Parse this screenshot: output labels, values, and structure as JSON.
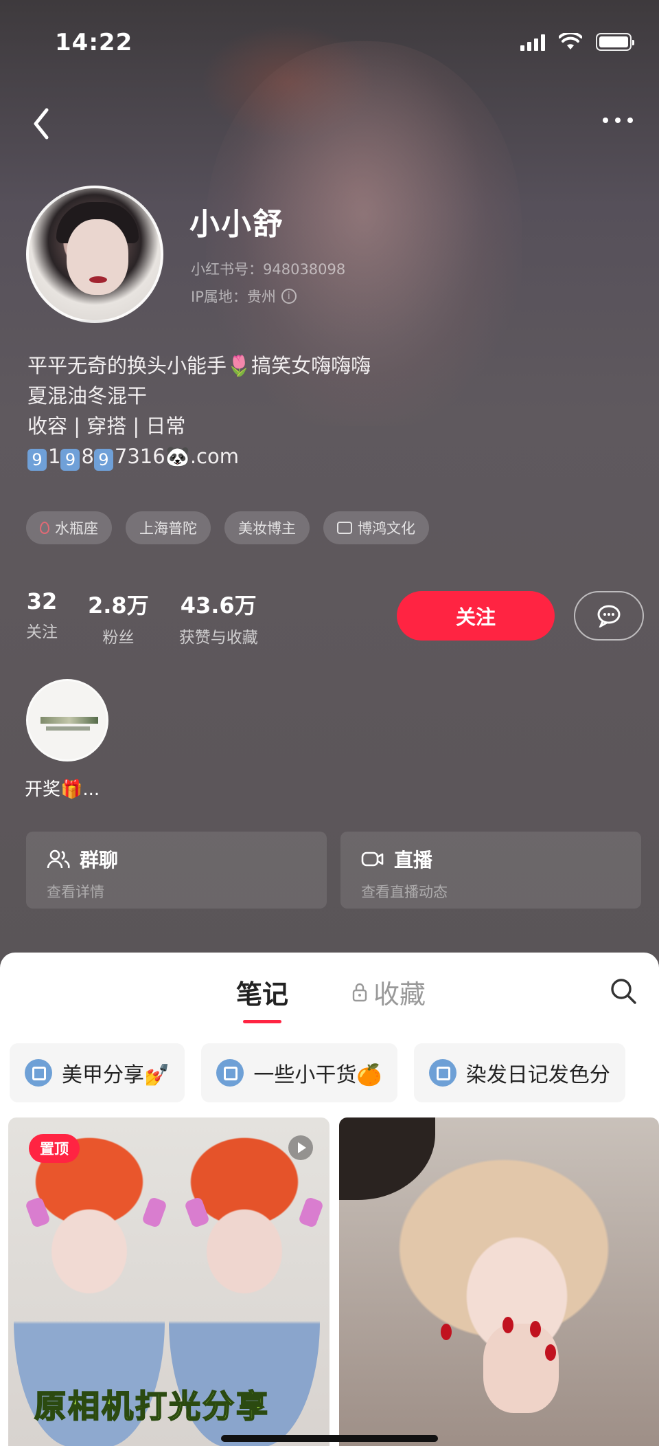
{
  "status_bar": {
    "time": "14:22"
  },
  "profile": {
    "username": "小小舒",
    "red_id": "小红书号：948038098",
    "ip_location": "IP属地：贵州",
    "bio_lines": [
      "平平无奇的换头小能手🌷搞笑女嗨嗨嗨",
      "夏混油冬混干",
      "收容 | 穿搭 | 日常"
    ],
    "contact": {
      "digits": [
        "9",
        "1",
        "9",
        "8",
        "9"
      ],
      "plain_1": "1",
      "plain_2": "8",
      "suffix": "7316",
      "emoji": "🐼",
      "domain": ".com"
    },
    "tags": [
      "水瓶座",
      "上海普陀",
      "美妆博主",
      "博鸿文化"
    ],
    "stats": [
      {
        "value": "32",
        "label": "关注"
      },
      {
        "value": "2.8万",
        "label": "粉丝"
      },
      {
        "value": "43.6万",
        "label": "获赞与收藏"
      }
    ],
    "follow_label": "关注",
    "highlight_label": "开奖🎁..."
  },
  "cards": [
    {
      "title": "群聊",
      "subtitle": "查看详情",
      "icon": "group-icon"
    },
    {
      "title": "直播",
      "subtitle": "查看直播动态",
      "icon": "live-icon"
    }
  ],
  "content": {
    "tabs": {
      "notes": "笔记",
      "favorites": "收藏"
    },
    "albums": [
      "美甲分享💅",
      "一些小干货🍊",
      "染发日记发色分"
    ],
    "notes": [
      {
        "badge": "置顶",
        "caption": "原相机打光分享"
      },
      {
        "badge": "",
        "caption": ""
      }
    ]
  },
  "colors": {
    "accent": "#ff2442",
    "album_icon": "#6ea0d6",
    "caption": "#b6f04a"
  }
}
